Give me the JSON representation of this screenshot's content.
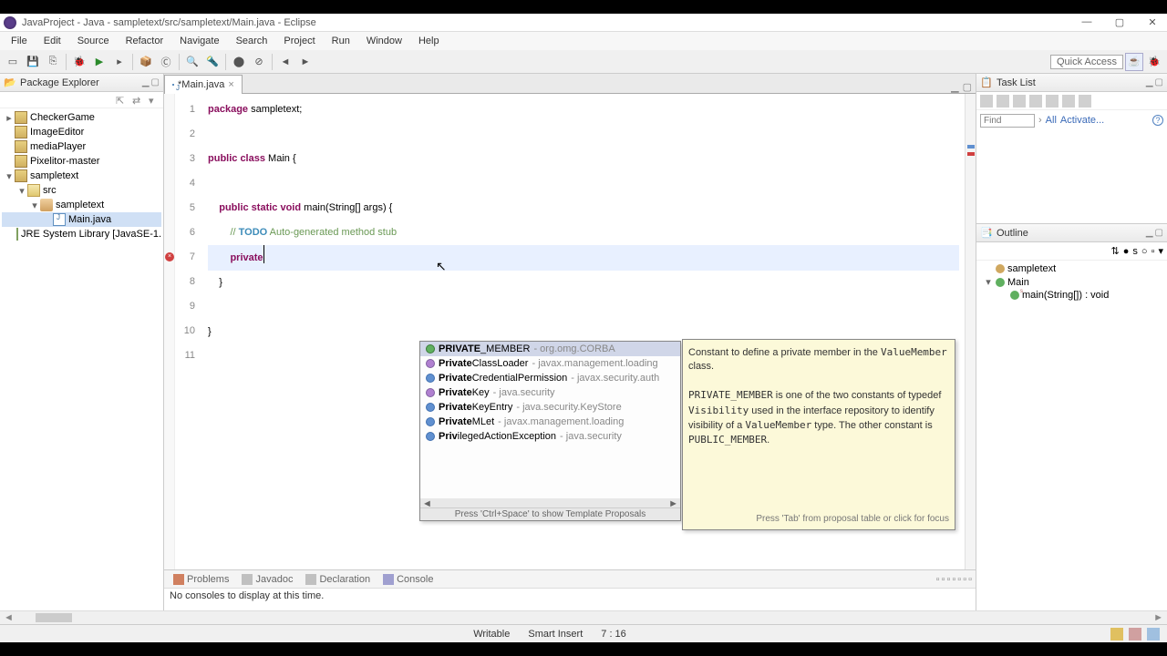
{
  "window": {
    "title": "JavaProject - Java - sampletext/src/sampletext/Main.java - Eclipse"
  },
  "menu": [
    "File",
    "Edit",
    "Source",
    "Refactor",
    "Navigate",
    "Search",
    "Project",
    "Run",
    "Window",
    "Help"
  ],
  "quick_access": "Quick Access",
  "package_explorer": {
    "title": "Package Explorer",
    "projects": [
      {
        "name": "CheckerGame",
        "expanded": false
      },
      {
        "name": "ImageEditor",
        "expanded": false,
        "no_expand": true
      },
      {
        "name": "mediaPlayer",
        "expanded": false,
        "no_expand": true
      },
      {
        "name": "Pixelitor-master",
        "expanded": false,
        "no_expand": true
      },
      {
        "name": "sampletext",
        "expanded": true,
        "children": [
          {
            "name": "src",
            "icon": "folder",
            "expanded": true,
            "children": [
              {
                "name": "sampletext",
                "icon": "pkg",
                "expanded": true,
                "children": [
                  {
                    "name": "Main.java",
                    "icon": "java",
                    "selected": true
                  }
                ]
              }
            ]
          },
          {
            "name": "JRE System Library [JavaSE-1.",
            "icon": "lib"
          }
        ]
      }
    ]
  },
  "editor": {
    "tab_label": "*Main.java",
    "lines": [
      {
        "n": "1",
        "segments": [
          {
            "t": "package",
            "c": "kw"
          },
          {
            "t": " sampletext;",
            "c": ""
          }
        ]
      },
      {
        "n": "2",
        "segments": []
      },
      {
        "n": "3",
        "segments": [
          {
            "t": "public class",
            "c": "kw"
          },
          {
            "t": " Main {",
            "c": ""
          }
        ]
      },
      {
        "n": "4",
        "segments": []
      },
      {
        "n": "5",
        "mark": "▸",
        "segments": [
          {
            "t": "    ",
            "c": ""
          },
          {
            "t": "public static void",
            "c": "kw"
          },
          {
            "t": " main(String[] args) {",
            "c": ""
          }
        ]
      },
      {
        "n": "6",
        "segments": [
          {
            "t": "        // ",
            "c": "comment"
          },
          {
            "t": "TODO",
            "c": "todo-kw"
          },
          {
            "t": " Auto-generated method stub",
            "c": "comment"
          }
        ]
      },
      {
        "n": "7",
        "highlight": true,
        "error": true,
        "segments": [
          {
            "t": "        ",
            "c": ""
          },
          {
            "t": "private",
            "c": "kw",
            "caret": true
          }
        ]
      },
      {
        "n": "8",
        "segments": [
          {
            "t": "    }",
            "c": ""
          }
        ]
      },
      {
        "n": "9",
        "segments": []
      },
      {
        "n": "10",
        "segments": [
          {
            "t": "}",
            "c": ""
          }
        ]
      },
      {
        "n": "11",
        "segments": []
      }
    ]
  },
  "autocomplete": {
    "items": [
      {
        "label": "PRIVATE_MEMBER",
        "pkg": " - org.omg.CORBA",
        "selected": true,
        "kind": "f",
        "strong": "PRIVATE"
      },
      {
        "label": "PrivateClassLoader",
        "pkg": " - javax.management.loading",
        "kind": "i",
        "strong": "Private"
      },
      {
        "label": "PrivateCredentialPermission",
        "pkg": " - javax.security.auth",
        "kind": "c",
        "strong": "Private"
      },
      {
        "label": "PrivateKey",
        "pkg": " - java.security",
        "kind": "i",
        "strong": "Private"
      },
      {
        "label": "PrivateKeyEntry",
        "pkg": " - java.security.KeyStore",
        "kind": "c",
        "strong": "Private"
      },
      {
        "label": "PrivateMLet",
        "pkg": " - javax.management.loading",
        "kind": "c",
        "strong": "Private"
      },
      {
        "label": "PrivilegedActionException",
        "pkg": " - java.security",
        "kind": "c",
        "strong": "Priv"
      }
    ],
    "footer": "Press 'Ctrl+Space' to show Template Proposals"
  },
  "doc": {
    "line1_pre": "Constant to define a private member in the ",
    "line1_code": "ValueMember",
    "line1_post": " class.",
    "line2_a": "PRIVATE_MEMBER",
    "line2_b": " is one of the two constants of typedef ",
    "line2_c": "Visibility",
    "line2_d": " used in the interface repository to identify visibility of a ",
    "line2_e": "ValueMember",
    "line2_f": " type. The other constant is ",
    "line2_g": "PUBLIC_MEMBER",
    "line2_h": ".",
    "footer": "Press 'Tab' from proposal table or click for focus"
  },
  "bottom_panel": {
    "tabs": [
      "Problems",
      "Javadoc",
      "Declaration",
      "Console"
    ],
    "console_msg": "No consoles to display at this time."
  },
  "task_list": {
    "title": "Task List",
    "find_placeholder": "Find",
    "all_link": "All",
    "activate_link": "Activate..."
  },
  "outline": {
    "title": "Outline",
    "items": [
      {
        "label": "sampletext",
        "icon": "o-pkg",
        "depth": 0
      },
      {
        "label": "Main",
        "icon": "o-class",
        "depth": 0,
        "expand": "▾"
      },
      {
        "label": "main(String[]) : void",
        "icon": "o-method",
        "depth": 1
      }
    ]
  },
  "status": {
    "writable": "Writable",
    "insert": "Smart Insert",
    "pos": "7 : 16"
  }
}
